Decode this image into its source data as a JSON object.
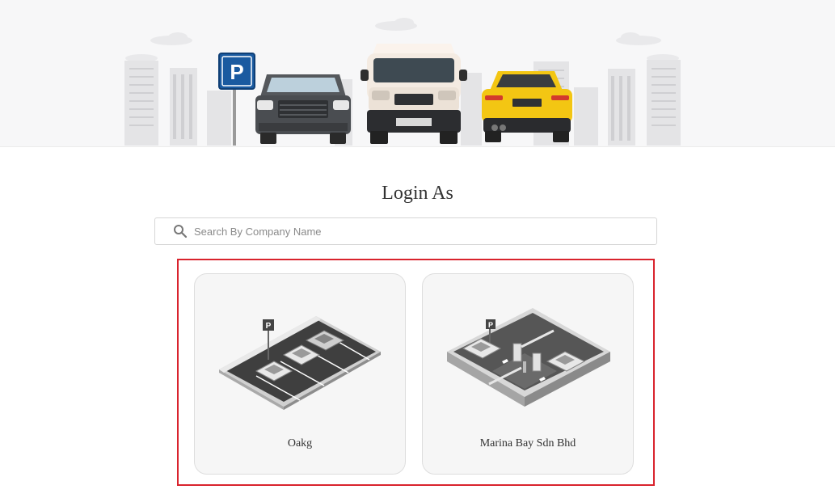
{
  "header": {
    "hero_illustration": "parking-cars-city-illustration",
    "parking_sign_letter": "P",
    "accent_colors": {
      "parking_sign": "#1a5aa0",
      "sports_car": "#f3c613"
    }
  },
  "page": {
    "title": "Login As"
  },
  "search": {
    "placeholder": "Search By Company Name",
    "value": "",
    "icon": "search-icon"
  },
  "companies": [
    {
      "name": "Oakg",
      "illustration": "parking-lot-icon"
    },
    {
      "name": "Marina Bay Sdn Bhd",
      "illustration": "parking-gate-icon"
    }
  ],
  "selection_highlight_color": "#d9232d"
}
